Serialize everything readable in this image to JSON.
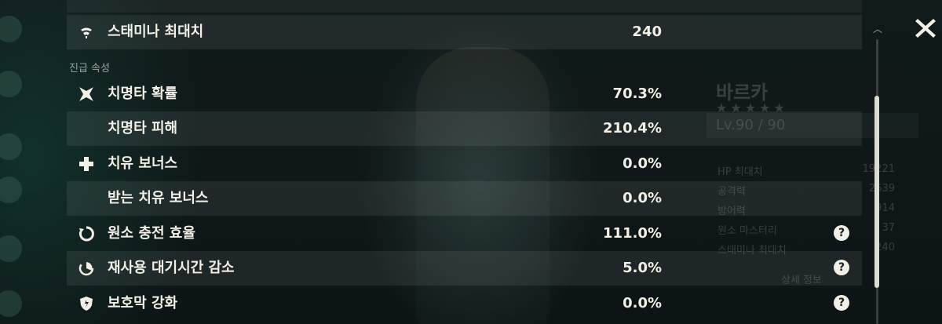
{
  "section_header": "진급 속성",
  "stats": [
    {
      "label": "스태미나 최대치",
      "value": "240",
      "icon": "stamina-icon",
      "help": false
    },
    {
      "label": "치명타 확률",
      "value": "70.3%",
      "icon": "crit-rate-icon",
      "help": false
    },
    {
      "label": "치명타 피해",
      "value": "210.4%",
      "icon": "",
      "help": false
    },
    {
      "label": "치유 보너스",
      "value": "0.0%",
      "icon": "healing-bonus-icon",
      "help": false
    },
    {
      "label": "받는 치유 보너스",
      "value": "0.0%",
      "icon": "",
      "help": false
    },
    {
      "label": "원소 충전 효율",
      "value": "111.0%",
      "icon": "energy-recharge-icon",
      "help": true
    },
    {
      "label": "재사용 대기시간 감소",
      "value": "5.0%",
      "icon": "cd-reduction-icon",
      "help": true
    },
    {
      "label": "보호막 강화",
      "value": "0.0%",
      "icon": "shield-strength-icon",
      "help": true
    }
  ],
  "help_glyph": "?",
  "close_icon": "close-icon",
  "scroll_up_glyph": "︿",
  "background_panel": {
    "name": "바르카",
    "stars": "★★★★★",
    "level": "Lv.90 / 90",
    "rows": [
      {
        "label": "HP 최대치",
        "value": "19221"
      },
      {
        "label": "공격력",
        "value": "2639"
      },
      {
        "label": "방어력",
        "value": "914"
      },
      {
        "label": "원소 마스터리",
        "value": "37"
      },
      {
        "label": "스태미나 최대치",
        "value": "240"
      }
    ],
    "detail_label": "상세 정보"
  },
  "colors": {
    "text": "#f2efe6",
    "muted": "#9aa3a1",
    "row_shade": "rgba(255,255,255,0.075)"
  }
}
